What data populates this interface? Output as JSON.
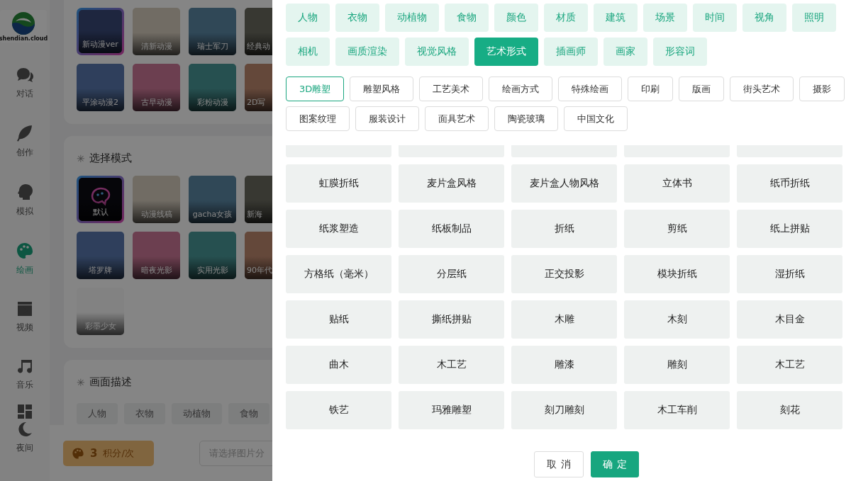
{
  "sidebar": {
    "logo_text": "shendian.cloud",
    "items": [
      {
        "label": "对话",
        "selected": false
      },
      {
        "label": "创作",
        "selected": false
      },
      {
        "label": "模拟",
        "selected": false
      },
      {
        "label": "绘画",
        "selected": true
      },
      {
        "label": "视频",
        "selected": false
      },
      {
        "label": "音乐",
        "selected": false
      },
      {
        "selected": false
      },
      {
        "label": "夜间",
        "selected": false
      }
    ]
  },
  "main": {
    "presets": {
      "tiles": [
        {
          "label": "新动漫ver",
          "selected": true
        },
        {
          "label": "清新动漫",
          "selected": false
        },
        {
          "label": "瑞士军刀",
          "selected": false
        },
        {
          "label": "经典动",
          "selected": false
        },
        {
          "label": "平涂动漫2",
          "selected": false
        },
        {
          "label": "古早动漫",
          "selected": false
        },
        {
          "label": "彩粉动漫",
          "selected": false
        },
        {
          "label": "2D写",
          "selected": false
        }
      ]
    },
    "mode": {
      "mark": "✳",
      "title": "选择模式",
      "tiles": [
        {
          "label": "默认",
          "kind": "icon",
          "selected": true
        },
        {
          "label": "动漫线稿",
          "kind": "photo",
          "selected": false
        },
        {
          "label": "gacha女孩",
          "kind": "photo",
          "selected": false
        },
        {
          "label": "新海",
          "kind": "photo",
          "selected": false
        },
        {
          "label": "塔罗牌",
          "kind": "photo",
          "selected": false
        },
        {
          "label": "暗夜光影",
          "kind": "photo",
          "selected": false
        },
        {
          "label": "实用光影",
          "kind": "photo",
          "selected": false
        },
        {
          "label": "90年代",
          "kind": "photo",
          "selected": false
        },
        {
          "label": "彩墨少女",
          "kind": "photo",
          "selected": false
        }
      ]
    },
    "description": {
      "mark": "✳",
      "title": "画面描述",
      "tags": [
        "人物",
        "衣物",
        "动植物",
        "食物"
      ]
    },
    "cost_button": {
      "amount": "3",
      "unit": "积分/次"
    },
    "category_field": {
      "placeholder": "请选择图片分"
    }
  },
  "drawer": {
    "categories": [
      {
        "label": "人物",
        "selected": false
      },
      {
        "label": "衣物",
        "selected": false
      },
      {
        "label": "动植物",
        "selected": false
      },
      {
        "label": "食物",
        "selected": false
      },
      {
        "label": "颜色",
        "selected": false
      },
      {
        "label": "材质",
        "selected": false
      },
      {
        "label": "建筑",
        "selected": false
      },
      {
        "label": "场景",
        "selected": false
      },
      {
        "label": "时间",
        "selected": false
      },
      {
        "label": "视角",
        "selected": false
      },
      {
        "label": "照明",
        "selected": false
      },
      {
        "label": "相机",
        "selected": false
      },
      {
        "label": "画质渲染",
        "selected": false
      },
      {
        "label": "视觉风格",
        "selected": false
      },
      {
        "label": "艺术形式",
        "selected": true
      },
      {
        "label": "插画师",
        "selected": false
      },
      {
        "label": "画家",
        "selected": false
      },
      {
        "label": "形容词",
        "selected": false
      }
    ],
    "subcategories": [
      {
        "label": "3D雕塑",
        "selected": true
      },
      {
        "label": "雕塑风格",
        "selected": false
      },
      {
        "label": "工艺美术",
        "selected": false
      },
      {
        "label": "绘画方式",
        "selected": false
      },
      {
        "label": "特殊绘画",
        "selected": false
      },
      {
        "label": "印刷",
        "selected": false
      },
      {
        "label": "版画",
        "selected": false
      },
      {
        "label": "街头艺术",
        "selected": false
      },
      {
        "label": "摄影",
        "selected": false
      },
      {
        "label": "图案纹理",
        "selected": false
      },
      {
        "label": "服装设计",
        "selected": false
      },
      {
        "label": "面具艺术",
        "selected": false
      },
      {
        "label": "陶瓷玻璃",
        "selected": false
      },
      {
        "label": "中国文化",
        "selected": false
      }
    ],
    "options": [
      "虹膜折纸",
      "麦片盒风格",
      "麦片盒人物风格",
      "立体书",
      "纸币折纸",
      "纸浆塑造",
      "纸板制品",
      "折纸",
      "剪纸",
      "纸上拼贴",
      "方格纸（毫米）",
      "分层纸",
      "正交投影",
      "模块折纸",
      "湿折纸",
      "贴纸",
      "撕纸拼贴",
      "木雕",
      "木刻",
      "木目金",
      "曲木",
      "木工艺",
      "雕漆",
      "雕刻",
      "木工艺",
      "铁艺",
      "玛雅雕塑",
      "刻刀雕刻",
      "木工车削",
      "刻花"
    ],
    "buttons": [
      {
        "label": "取消",
        "kind": "secondary"
      },
      {
        "label": "确定",
        "kind": "primary"
      }
    ]
  }
}
